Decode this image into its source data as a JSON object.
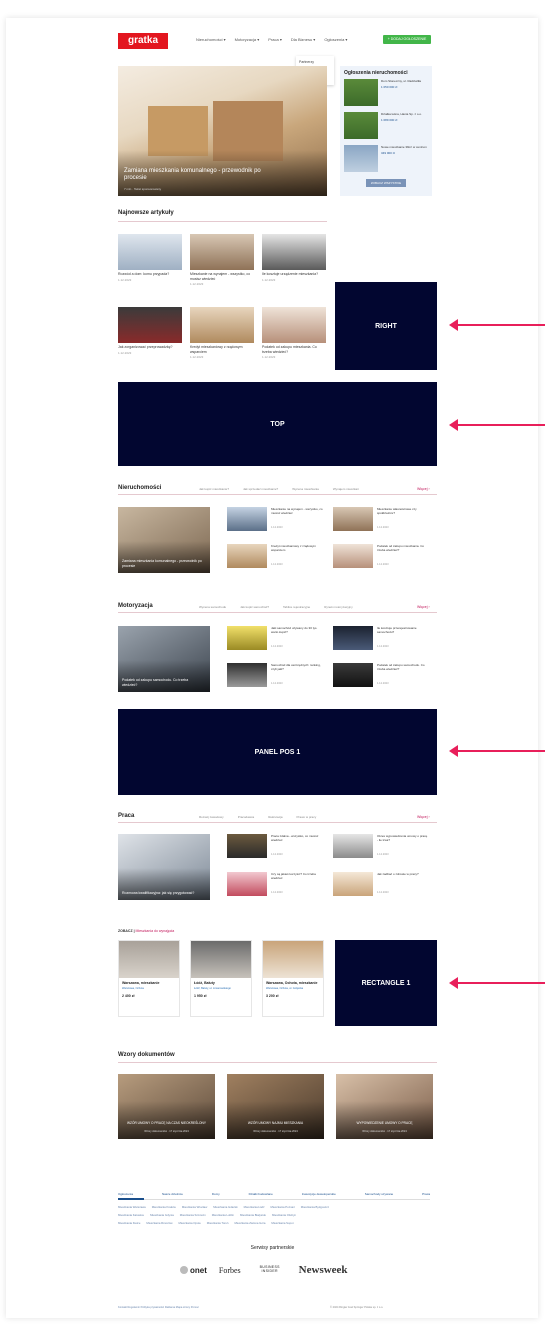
{
  "header": {
    "logo": "gratka",
    "nav": [
      "Nieruchomości ▾",
      "Motoryzacja ▾",
      "Praca ▾",
      "Dla Biznesu ▾",
      "Ogłoszenia ▾"
    ],
    "add_button": "+ DODAJ OGŁOSZENIE",
    "dropdown": [
      "Partnerzy Nieruchomości",
      "Partnerzy Motoryzacja",
      "Partnerzy Praca"
    ]
  },
  "hero": {
    "title": "Zamiana mieszkania komunalnego - przewodnik po procesie",
    "meta": "7 min  ·  Tekst sponsorowany"
  },
  "listings": {
    "title": "Ogłoszenia nieruchomości",
    "items": [
      {
        "name": "Dom Słoneczny, ul. Radziwiłła",
        "price": "1 050 000 zł"
      },
      {
        "name": "Działka leśna, Hania Sp. z o.o.",
        "price": "1 089 000 zł"
      },
      {
        "name": "Nowe mieszkanie 39m² w centrum",
        "price": "349 000 zł"
      }
    ],
    "button": "ZOBACZ WSZYSTKIE"
  },
  "latest": {
    "title": "Najnowsze artykuły",
    "articles": [
      {
        "title": "Rozwód a dom: komu przypada?",
        "date": "1.12.2023"
      },
      {
        "title": "Mieszkanie na wynajem - wszystko, co musisz wiedzieć",
        "date": "1.12.2023"
      },
      {
        "title": "Ile kosztuje urządzenie mieszkania?",
        "date": "1.12.2023"
      },
      {
        "title": "Jak zorganizować przeprowadzkę?",
        "date": "1.12.2023"
      },
      {
        "title": "Kredyt mieszkaniowy z rządowym wsparciem",
        "date": "1.12.2023"
      },
      {
        "title": "Podatek od zakupu mieszkania. Co trzeba wiedzieć?",
        "date": "1.12.2023"
      }
    ]
  },
  "ads": {
    "right": "RIGHT",
    "top": "TOP",
    "panel": "PANEL POS 1",
    "rect": "RECTANGLE 1"
  },
  "sections": [
    {
      "title": "Nieruchomości",
      "links": [
        "Jak kupić mieszkanie?",
        "Jak sprzedać mieszkanie?",
        "Wycena mieszkania",
        "Wynajem mieszkań"
      ],
      "more": "Więcej ›",
      "main": "Zamiana mieszkania komunalnego - przewodnik po procesie",
      "items": [
        {
          "title": "Mieszkanie na wynajem - wszystko, co musisz wiedzieć",
          "date": "1.12.2023"
        },
        {
          "title": "Mieszkanie własnościowe czy spółdzielcze?",
          "date": "1.12.2023"
        },
        {
          "title": "Kredyt mieszkaniowy z rządowym wsparciem",
          "date": "1.12.2023"
        },
        {
          "title": "Podatek od zakupu mieszkania. Co trzeba wiedzieć?",
          "date": "1.12.2023"
        }
      ]
    },
    {
      "title": "Motoryzacja",
      "links": [
        "Wycena samochodu",
        "Jak kupić samochód?",
        "Tablice rejestracyjne",
        "Rynek motoryzacyjny"
      ],
      "more": "Więcej ›",
      "main": "Podatek od zakupu samochodu. Co trzeba wiedzieć?",
      "items": [
        {
          "title": "Jaki samochód używany do 30 tys. warto kupić?",
          "date": "1.12.2023"
        },
        {
          "title": "Ile kosztuje przerejestrowanie samochodu?",
          "date": "1.12.2023"
        },
        {
          "title": "Samochód dla oszczędnych: ranking, czyli jaki?",
          "date": "1.12.2023"
        },
        {
          "title": "Podatek od zakupu samochodu. Co trzeba wiedzieć?",
          "date": "1.12.2023"
        }
      ]
    },
    {
      "title": "Praca",
      "links": [
        "Rozwój zawodowy",
        "Pracodawca",
        "Rekrutacja",
        "Prawo w pracy"
      ],
      "more": "Więcej ›",
      "main": "Rozmowa kwalifikacyjna: jak się przygotować?",
      "items": [
        {
          "title": "Praca zdalna - wszystko, co musisz wiedzieć",
          "date": "1.12.2023"
        },
        {
          "title": "Okres wypowiedzenia umowy o pracę - ile trwa?",
          "date": "1.12.2023"
        },
        {
          "title": "Czy są jakieś korzyści? Co trzeba wiedzieć",
          "date": "1.12.2023"
        },
        {
          "title": "Jak zadbać o zdrowie w pracy?",
          "date": "1.12.2023"
        }
      ]
    }
  ],
  "rect_offers": {
    "label": "ZOBACZ",
    "label_link": "Mieszkania do wynajęcia",
    "cards": [
      {
        "title": "Warszawa, mieszkanie",
        "location": "Warszawa, Ochota",
        "price": "2 400 zł"
      },
      {
        "title": "Łódź, Bałuty",
        "location": "Łódź, Bałuty, ul. Limanowskiego",
        "price": "1 950 zł"
      },
      {
        "title": "Warszawa, Ochota, mieszkanie",
        "location": "Warszawa, Ochota, ul. Grójecka",
        "price": "3 200 zł"
      }
    ]
  },
  "documents": {
    "title": "Wzory dokumentów",
    "items": [
      {
        "title": "WZÓR UMOWY O PRACĘ NA CZAS NIEOKREŚLONY",
        "meta": "Wzory dokumentów  ·  17 stycznia 2024"
      },
      {
        "title": "WZÓR UMOWY NAJMU MIESZKANIA",
        "meta": "Wzory dokumentów  ·  17 stycznia 2024"
      },
      {
        "title": "WYPOWIEDZENIE UMOWY O PRACĘ",
        "meta": "Wzory dokumentów  ·  17 stycznia 2024"
      }
    ]
  },
  "footer": {
    "tabs": [
      "Ogłoszenia",
      "Nasze dzielnice",
      "Domy",
      "Działki budowlane",
      "Inwestycje deweloperskie",
      "Samochody używane",
      "Praca"
    ],
    "links": [
      "Mieszkania Warszawa",
      "Mieszkania Kraków",
      "Mieszkania Wrocław",
      "Mieszkania Gdańsk",
      "Mieszkania Łódź",
      "Mieszkania Poznań",
      "Mieszkania Bydgoszcz",
      "Mieszkania Katowice",
      "Mieszkania Gdynia",
      "Mieszkania Szczecin",
      "Mieszkania Lublin",
      "Mieszkania Białystok",
      "Mieszkania Olsztyn",
      "Mieszkania Kielce",
      "Mieszkania Rzeszów",
      "Mieszkania Opole",
      "Mieszkania Toruń",
      "Mieszkania Zielona Góra",
      "Mieszkania Sopot"
    ],
    "partners_title": "Serwisy partnerskie",
    "partners": [
      "onet",
      "Forbes",
      "BUSINESS INSIDER",
      "Newsweek"
    ],
    "bottom_links": "Kontakt  Regulamin  Polityka prywatności  Reklama  Mapa strony  Pomoc",
    "copyright": "© 2024 Ringier Axel Springer Polska sp. z o.o."
  },
  "colors": {
    "brand": "#e3161f",
    "ad": "#020630",
    "arrow": "#e81f5a",
    "accent": "#c2185b"
  }
}
